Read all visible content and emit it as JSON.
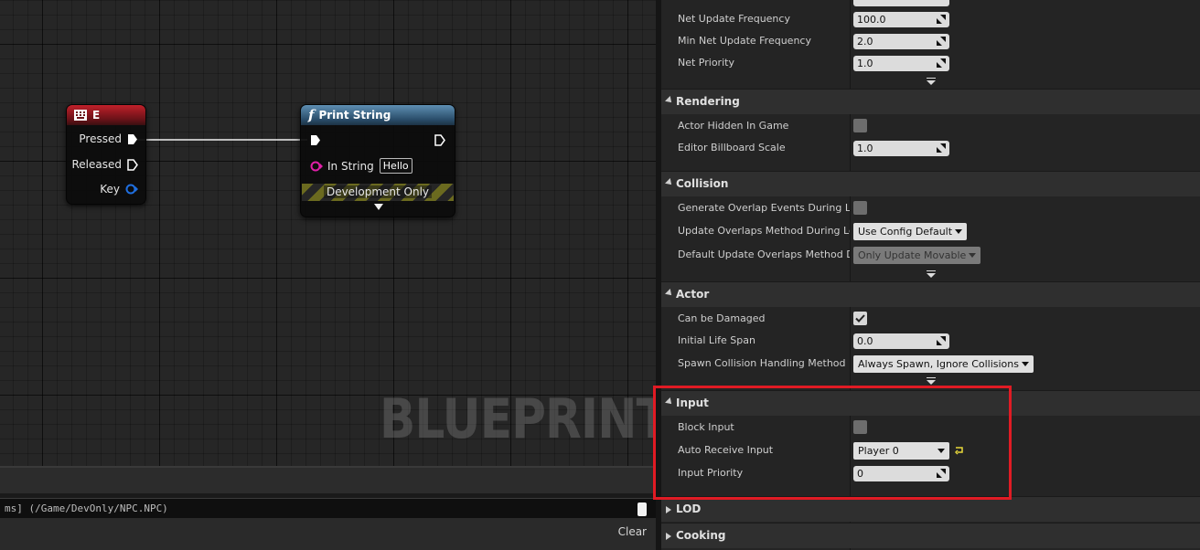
{
  "graph": {
    "watermark": "BLUEPRINT",
    "key_node": {
      "title": "E",
      "pins": [
        "Pressed",
        "Released",
        "Key"
      ]
    },
    "print_node": {
      "title": "Print String",
      "in_string_label": "In String",
      "in_string_value": "Hello",
      "dev_label": "Development Only"
    }
  },
  "log": {
    "text": "ms] (/Game/DevOnly/NPC.NPC)",
    "clear_label": "Clear"
  },
  "details": {
    "top_rows": [
      {
        "label": "Net Update Frequency",
        "value": "100.0"
      },
      {
        "label": "Min Net Update Frequency",
        "value": "2.0"
      },
      {
        "label": "Net Priority",
        "value": "1.0"
      }
    ],
    "rendering": {
      "title": "Rendering",
      "actor_hidden_label": "Actor Hidden In Game",
      "billboard_label": "Editor Billboard Scale",
      "billboard_value": "1.0"
    },
    "collision": {
      "title": "Collision",
      "gen_overlap_label": "Generate Overlap Events During Level",
      "update_overlap_label": "Update Overlaps Method During Level",
      "update_overlap_value": "Use Config Default",
      "default_overlap_label": "Default Update Overlaps Method Durin",
      "default_overlap_value": "Only Update Movable"
    },
    "actor": {
      "title": "Actor",
      "damaged_label": "Can be Damaged",
      "lifespan_label": "Initial Life Span",
      "lifespan_value": "0.0",
      "spawn_label": "Spawn Collision Handling Method",
      "spawn_value": "Always Spawn, Ignore Collisions"
    },
    "input": {
      "title": "Input",
      "block_label": "Block Input",
      "auto_label": "Auto Receive Input",
      "auto_value": "Player 0",
      "priority_label": "Input Priority",
      "priority_value": "0"
    },
    "lod": {
      "title": "LOD"
    },
    "cooking": {
      "title": "Cooking"
    }
  },
  "colors": {
    "highlight": "#e01b24",
    "key_node_header": "#c0202a",
    "function_node_header": "#5e8fb3"
  }
}
